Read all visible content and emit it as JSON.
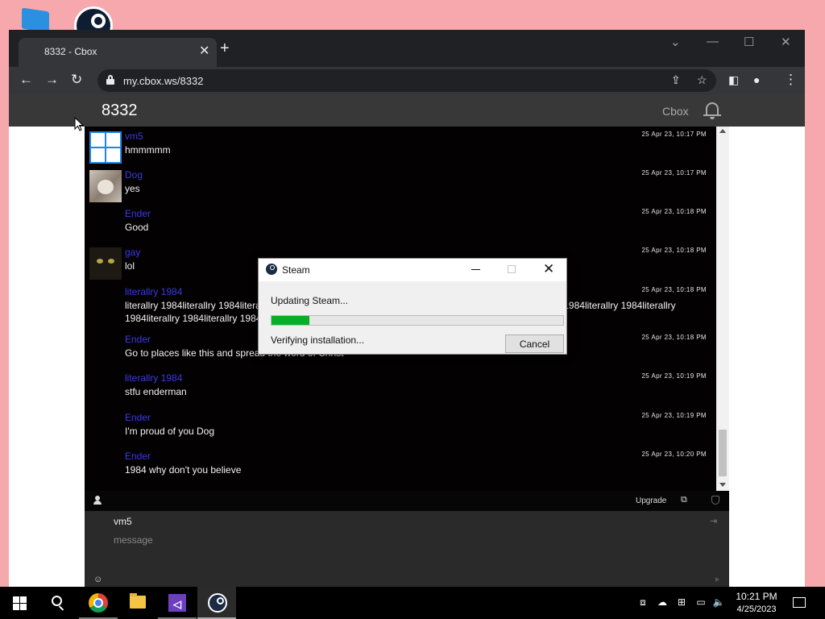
{
  "browser": {
    "tab_title": "8332 - Cbox",
    "tab_close": "✕",
    "new_tab": "+",
    "url": "my.cbox.ws/8332"
  },
  "site": {
    "title": "8332",
    "brand": "Cbox"
  },
  "messages": [
    {
      "user": "vm5",
      "text": "hmmmmm",
      "time": "25 Apr 23, 10:17 PM",
      "avatar": "windows-logo"
    },
    {
      "user": "Dog",
      "text": "yes",
      "time": "25 Apr 23, 10:17 PM",
      "avatar": "dog-photo"
    },
    {
      "user": "Ender",
      "text": "Good",
      "time": "25 Apr 23, 10:18 PM",
      "avatar": "none"
    },
    {
      "user": "gay",
      "text": "lol",
      "time": "25 Apr 23, 10:18 PM",
      "avatar": "cat-photo"
    },
    {
      "user": "literallry 1984",
      "text": "literallry 1984literallry 1984literallry 1984literallry 1984literallry 1984literallry 1984literallry 1984literallry 1984literallry 1984literallry",
      "text2": "1984literallry 1984literallry 1984literallry 1984",
      "time": "25 Apr 23, 10:18 PM",
      "avatar": "none"
    },
    {
      "user": "Ender",
      "text": "Go to places like this and spread the word of Christ",
      "time": "25 Apr 23, 10:18 PM",
      "avatar": "none"
    },
    {
      "user": "literallry 1984",
      "text": "stfu enderman",
      "time": "25 Apr 23, 10:19 PM",
      "avatar": "none"
    },
    {
      "user": "Ender",
      "text": "I'm proud of you Dog",
      "time": "25 Apr 23, 10:19 PM",
      "avatar": "none"
    },
    {
      "user": "Ender",
      "text": "1984 why don't you believe",
      "time": "25 Apr 23, 10:20 PM",
      "avatar": "none"
    }
  ],
  "chatbar": {
    "upgrade_label": "Upgrade"
  },
  "compose": {
    "username": "vm5",
    "placeholder": "message"
  },
  "steam_dialog": {
    "title": "Steam",
    "status": "Updating Steam...",
    "progress": 0.13,
    "sub_status": "Verifying installation...",
    "cancel_label": "Cancel"
  },
  "taskbar": {
    "time": "10:21 PM",
    "date": "4/25/2023"
  },
  "colors": {
    "desktop": "#f7a8ad",
    "username_link": "#3a3ae6",
    "progress_fill": "#06b025",
    "chat_bg": "#040102"
  }
}
